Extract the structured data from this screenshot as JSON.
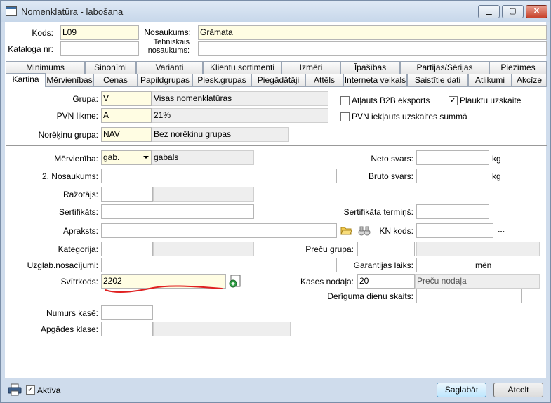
{
  "window": {
    "title": "Nomenklatūra - labošana",
    "minimize": "▁",
    "maximize": "▢",
    "close": "✕"
  },
  "header": {
    "kods_label": "Kods:",
    "kods_value": "L09",
    "kataloga_label": "Kataloga nr:",
    "kataloga_value": "",
    "nosaukums_label": "Nosaukums:",
    "nosaukums_value": "Grāmata",
    "tehniskais_label1": "Tehniskais",
    "tehniskais_label2": "nosaukums:",
    "tehniskais_value": ""
  },
  "tabs_back": [
    "Minimums",
    "Sinonīmi",
    "Varianti",
    "Klientu sortimenti",
    "Izmēri",
    "Īpašības",
    "Partijas/Sērijas",
    "Piezīmes"
  ],
  "tabs_front": [
    "Kartiņa",
    "Mērvienības",
    "Cenas",
    "Papildgrupas",
    "Piesk.grupas",
    "Piegādātāji",
    "Attēls",
    "Interneta veikals",
    "Saistītie dati",
    "Atlikumi",
    "Akcīze"
  ],
  "card": {
    "grupa_label": "Grupa:",
    "grupa_code": "V",
    "grupa_name": "Visas nomenklatūras",
    "pvn_label": "PVN likme:",
    "pvn_code": "A",
    "pvn_value": "21%",
    "noreķinu_label": "Norēķinu grupa:",
    "noreķinu_code": "NAV",
    "noreķinu_name": "Bez norēķinu grupas",
    "b2b_label": "Atļauts B2B eksports",
    "b2b_checked": "",
    "plauktu_label": "Plauktu uzskaite",
    "plauktu_checked": "✓",
    "pvn_summa_label": "PVN iekļauts uzskaites summā",
    "pvn_summa_checked": "",
    "merv_label": "Mērvienība:",
    "merv_value": "gab.",
    "merv_name": "gabals",
    "nos2_label": "2. Nosaukums:",
    "nos2_value": "",
    "razotajs_label": "Ražotājs:",
    "razotajs_value": "",
    "sertif_label": "Sertifikāts:",
    "sertif_value": "",
    "apraksts_label": "Apraksts:",
    "apraksts_value": "",
    "kategorija_label": "Kategorija:",
    "kategorija_value": "",
    "uzglab_label": "Uzglab.nosacījumi:",
    "uzglab_value": "",
    "svitr_label": "Svītrkods:",
    "svitr_value": "2202",
    "numurs_label": "Numurs kasē:",
    "numurs_value": "",
    "apgades_label": "Apgādes klase:",
    "apgades_value": "",
    "neto_label": "Neto svars:",
    "neto_value": "",
    "neto_unit": "kg",
    "bruto_label": "Bruto svars:",
    "bruto_value": "",
    "bruto_unit": "kg",
    "sert_term_label": "Sertifikāta termiņš:",
    "sert_term_value": "",
    "kn_label": "KN kods:",
    "kn_value": "",
    "kn_more": "...",
    "precu_grupa_label": "Preču grupa:",
    "precu_grupa_value": "",
    "garantijas_label": "Garantijas laiks:",
    "garantijas_value": "",
    "garantijas_unit": "mēn",
    "kases_label": "Kases nodaļa:",
    "kases_code": "20",
    "kases_name": "Preču nodaļa",
    "deriguma_label": "Derīguma dienu skaits:",
    "deriguma_value": ""
  },
  "footer": {
    "aktiva_label": "Aktīva",
    "aktiva_checked": "✓",
    "save_label": "Saglabāt",
    "cancel_label": "Atcelt"
  },
  "colors": {
    "required_field": "#fffde3",
    "readonly_field": "#eeeeee",
    "annotation": "#e02020"
  }
}
